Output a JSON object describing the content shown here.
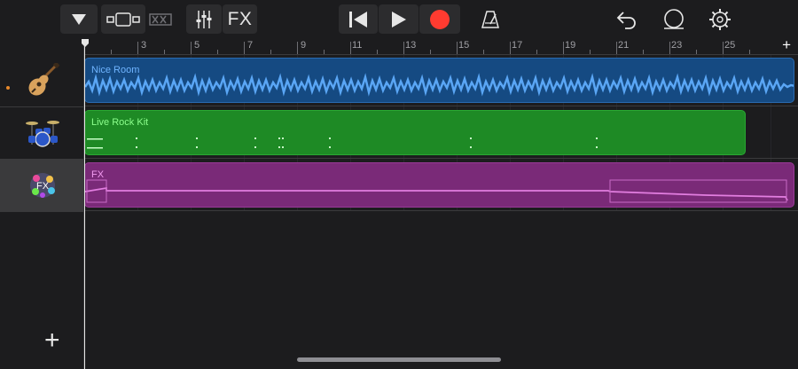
{
  "app": {
    "name": "GarageBand tracks view"
  },
  "toolbar": {
    "fx_label": "FX",
    "buttons": [
      {
        "name": "browser-menu",
        "icon": "triangle-down-icon"
      },
      {
        "name": "tracks-view",
        "icon": "tracks-view-icon"
      },
      {
        "name": "live-loops",
        "icon": "live-loops-icon"
      },
      {
        "name": "mixer",
        "icon": "mixer-sliders-icon"
      },
      {
        "name": "fx",
        "icon": "fx-text"
      },
      {
        "name": "go-to-start",
        "icon": "skip-back-icon"
      },
      {
        "name": "play",
        "icon": "play-icon"
      },
      {
        "name": "record",
        "icon": "record-icon"
      },
      {
        "name": "metronome",
        "icon": "metronome-icon"
      },
      {
        "name": "undo",
        "icon": "undo-icon"
      },
      {
        "name": "loop-browser",
        "icon": "loop-icon"
      },
      {
        "name": "settings",
        "icon": "gear-icon"
      }
    ],
    "record_color": "#ff3b30"
  },
  "ruler": {
    "bar_numbers": [
      "3",
      "5",
      "7",
      "9",
      "11",
      "13",
      "15",
      "17",
      "19",
      "21",
      "23",
      "25"
    ],
    "add_section": "+"
  },
  "tracks": [
    {
      "instrument_icon": "acoustic-guitar-icon",
      "region_name": "Nice Room",
      "color": "#154a82",
      "label_color": "#6fb4ff",
      "armed": true
    },
    {
      "instrument_icon": "drum-kit-icon",
      "region_name": "Live Rock Kit",
      "color": "#1e8a25",
      "label_color": "#8cff8c",
      "armed": false
    },
    {
      "instrument_icon": "fx-ball-icon",
      "region_name": "FX",
      "color": "#7a2a78",
      "label_color": "#f29bf0",
      "armed": false,
      "selected": true
    }
  ],
  "add_track_label": "+"
}
